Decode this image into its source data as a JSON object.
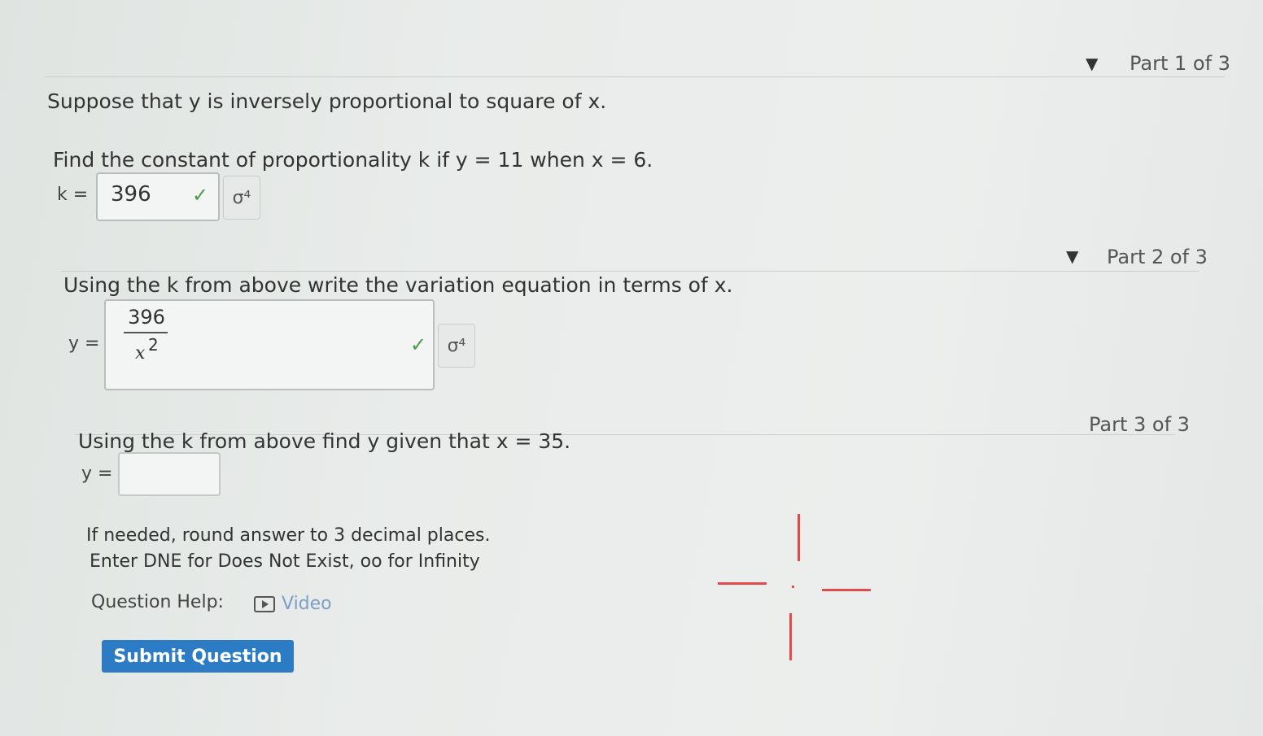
{
  "part1": {
    "header": "Part 1 of 3",
    "intro": "Suppose that y is inversely proportional to square of x.",
    "prompt": "Find the constant of proportionality k if y = 11 when x = 6.",
    "answer_label": "k =",
    "answer_value": "396"
  },
  "part2": {
    "header": "Part 2 of 3",
    "prompt": "Using the k from above write the variation equation in terms of x.",
    "answer_label": "y =",
    "numerator": "396",
    "denominator_var": "x",
    "denominator_exp": "2"
  },
  "part3": {
    "header": "Part 3 of 3",
    "prompt": "Using the k from above find y given that x = 35.",
    "answer_label": "y =",
    "answer_value": "",
    "note1": "If needed, round answer to 3 decimal places.",
    "note2": "Enter DNE for Does Not Exist, oo for Infinity"
  },
  "help": {
    "label": "Question Help:",
    "video_label": "Video"
  },
  "submit_label": "Submit Question",
  "icons": {
    "caret": "▼",
    "check": "✓",
    "equation_editor": "σ⁴"
  },
  "colors": {
    "submit_bg": "#2b7bc5",
    "check": "#4a9a4a",
    "link": "#7b9fc5"
  }
}
